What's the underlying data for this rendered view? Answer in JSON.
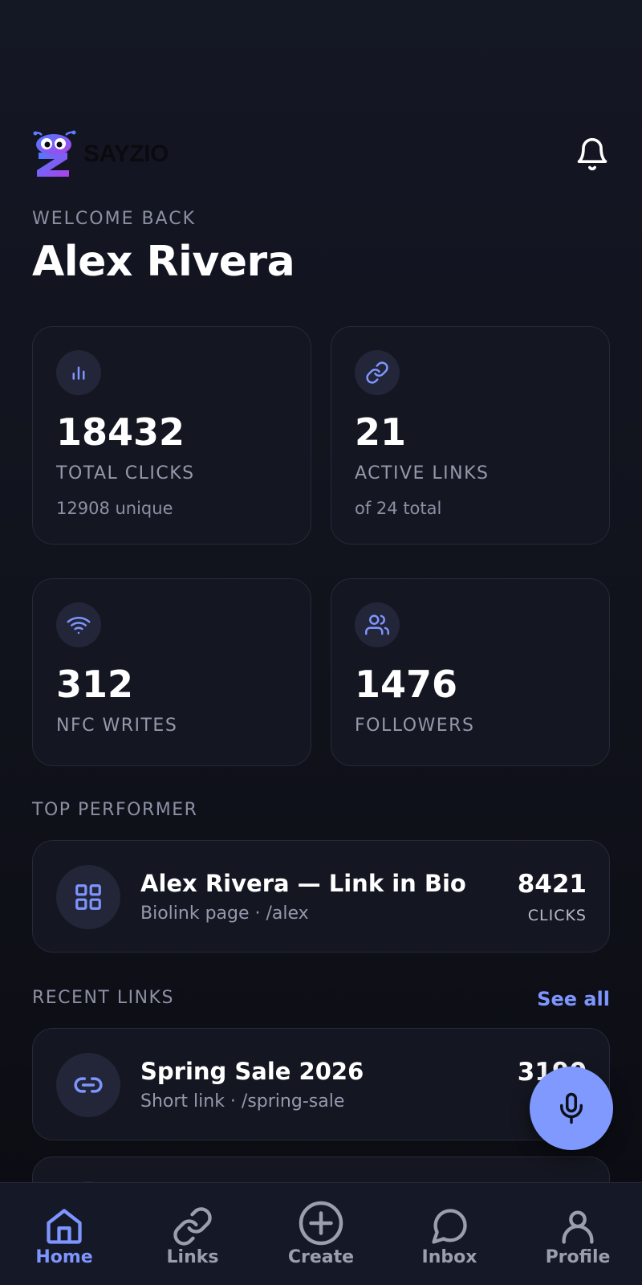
{
  "app": {
    "brand": "SAYZIO"
  },
  "welcome": {
    "label": "WELCOME BACK",
    "name": "Alex Rivera"
  },
  "stats": [
    {
      "icon": "bar-chart-icon",
      "value": "18432",
      "label": "TOTAL CLICKS",
      "sub": "12908 unique"
    },
    {
      "icon": "link-icon",
      "value": "21",
      "label": "ACTIVE LINKS",
      "sub": "of 24 total"
    },
    {
      "icon": "wifi-icon",
      "value": "312",
      "label": "NFC WRITES",
      "sub": ""
    },
    {
      "icon": "users-icon",
      "value": "1476",
      "label": "FOLLOWERS",
      "sub": ""
    }
  ],
  "top_performer": {
    "section_label": "TOP PERFORMER",
    "icon": "grid-icon",
    "title": "Alex Rivera — Link in Bio",
    "subtitle": "Biolink page · /alex",
    "count": "8421",
    "count_label": "CLICKS"
  },
  "recent_links": {
    "section_label": "RECENT LINKS",
    "see_all": "See all",
    "items": [
      {
        "icon": "link-icon",
        "title": "Spring Sale 2026",
        "subtitle": "Short link · /spring-sale",
        "count": "3190"
      }
    ]
  },
  "nav": {
    "items": [
      {
        "label": "Home",
        "icon": "home-icon",
        "active": true
      },
      {
        "label": "Links",
        "icon": "link-icon",
        "active": false
      },
      {
        "label": "Create",
        "icon": "plus-circle-icon",
        "active": false
      },
      {
        "label": "Inbox",
        "icon": "chat-bubble-icon",
        "active": false
      },
      {
        "label": "Profile",
        "icon": "user-icon",
        "active": false
      }
    ]
  },
  "colors": {
    "background": "#10121b",
    "card": "#141621",
    "card_border": "#262938",
    "accent": "#7e95ff",
    "fab": "#7f99ff",
    "muted_text": "#8b90a3"
  },
  "fab_icon": "microphone-icon",
  "notification_icon": "bell-icon"
}
